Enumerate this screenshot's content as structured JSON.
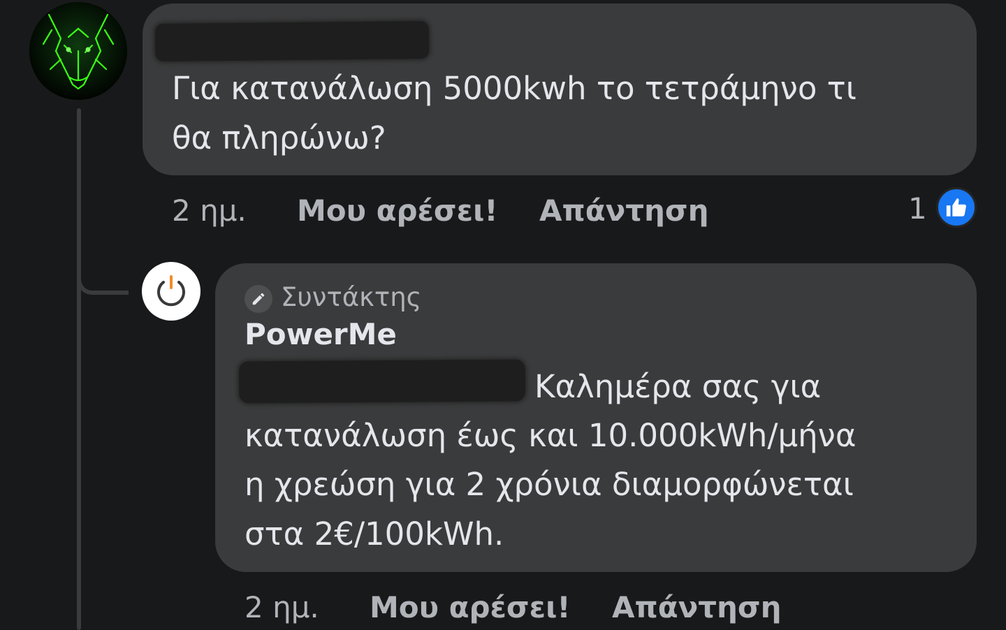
{
  "comment": {
    "author_name_redacted": true,
    "text_lines": [
      "Για κατανάλωση 5000kwh το τετράμηνο τι",
      "θα πληρώνω?"
    ],
    "time": "2 ημ.",
    "like_label": "Μου αρέσει!",
    "reply_label": "Απάντηση",
    "reaction_count": "1",
    "reaction_icon": "like-thumb-icon",
    "avatar_icon": "green-wolf-avatar"
  },
  "reply": {
    "role_icon": "pencil-icon",
    "role": "Συντάκτης",
    "author": "PowerMe",
    "mention_redacted": true,
    "text_lines": [
      "Καλημέρα σας για",
      "κατανάλωση έως και 10.000kWh/μήνα",
      "η χρεώση για 2 χρόνια διαμορφώνεται",
      "στα 2€/100kWh."
    ],
    "time": "2 ημ.",
    "like_label": "Μου αρέσει!",
    "reply_label": "Απάντηση",
    "avatar_icon": "power-button-logo",
    "colors": {
      "logo_accent": "#f28c28"
    }
  },
  "colors": {
    "background": "#18191a",
    "bubble": "#3a3b3c",
    "primary_text": "#e4e6eb",
    "secondary_text": "#b0b3b8",
    "like_blue": "#1877f2"
  }
}
